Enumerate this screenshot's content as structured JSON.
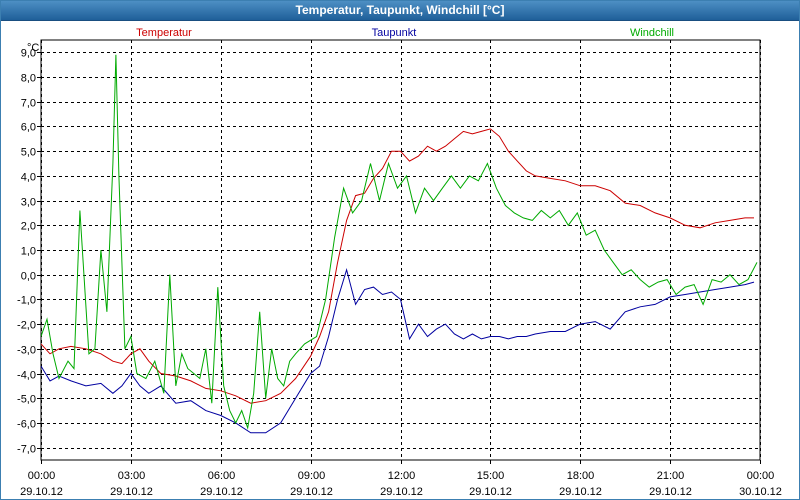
{
  "window": {
    "title": "Temperatur, Taupunkt, Windchill [°C]"
  },
  "chart_data": {
    "type": "line",
    "title": "Temperatur, Taupunkt, Windchill [°C]",
    "ylabel": "°C",
    "xlabel": "",
    "ylim": [
      -7.5,
      9.5
    ],
    "xlim": [
      0,
      24
    ],
    "grid": true,
    "legend_position": "top",
    "y_ticks": [
      "9,0",
      "8,0",
      "7,0",
      "6,0",
      "5,0",
      "4,0",
      "3,0",
      "2,0",
      "1,0",
      "0,0",
      "-1,0",
      "-2,0",
      "-3,0",
      "-4,0",
      "-5,0",
      "-6,0",
      "-7,0"
    ],
    "y_tick_values": [
      9,
      8,
      7,
      6,
      5,
      4,
      3,
      2,
      1,
      0,
      -1,
      -2,
      -3,
      -4,
      -5,
      -6,
      -7
    ],
    "x_ticks": [
      {
        "time": "00:00",
        "date": "29.10.12"
      },
      {
        "time": "03:00",
        "date": "29.10.12"
      },
      {
        "time": "06:00",
        "date": "29.10.12"
      },
      {
        "time": "09:00",
        "date": "29.10.12"
      },
      {
        "time": "12:00",
        "date": "29.10.12"
      },
      {
        "time": "15:00",
        "date": "29.10.12"
      },
      {
        "time": "18:00",
        "date": "29.10.12"
      },
      {
        "time": "21:00",
        "date": "29.10.12"
      },
      {
        "time": "00:00",
        "date": "30.10.12"
      }
    ],
    "x_tick_hours": [
      0,
      3,
      6,
      9,
      12,
      15,
      18,
      21,
      24
    ],
    "series": [
      {
        "name": "Temperatur",
        "color": "#cc0000",
        "x": [
          0,
          0.3,
          0.6,
          1.0,
          1.5,
          2.0,
          2.4,
          2.7,
          3.0,
          3.3,
          3.6,
          4.0,
          4.5,
          5.0,
          5.5,
          6.0,
          6.5,
          7.0,
          7.5,
          8.0,
          8.5,
          9.0,
          9.3,
          9.6,
          9.9,
          10.2,
          10.5,
          10.8,
          11.1,
          11.4,
          11.7,
          12.0,
          12.3,
          12.6,
          12.9,
          13.2,
          13.5,
          13.8,
          14.1,
          14.4,
          14.7,
          15.0,
          15.3,
          15.6,
          15.9,
          16.2,
          16.5,
          17.0,
          17.5,
          18.0,
          18.5,
          19.0,
          19.5,
          20.0,
          20.5,
          21.0,
          21.5,
          22.0,
          22.5,
          23.0,
          23.5,
          23.8
        ],
        "y": [
          -2.8,
          -3.2,
          -3.0,
          -2.9,
          -3.0,
          -3.2,
          -3.5,
          -3.6,
          -3.2,
          -3.0,
          -3.5,
          -4.0,
          -4.1,
          -4.3,
          -4.6,
          -4.7,
          -4.9,
          -5.2,
          -5.1,
          -4.8,
          -4.2,
          -3.3,
          -2.5,
          -1.5,
          0.5,
          2.2,
          3.2,
          3.3,
          3.9,
          4.3,
          5.0,
          5.0,
          4.6,
          4.8,
          5.2,
          5.0,
          5.2,
          5.5,
          5.8,
          5.7,
          5.8,
          5.9,
          5.6,
          5.0,
          4.6,
          4.2,
          4.0,
          3.9,
          3.8,
          3.6,
          3.6,
          3.4,
          2.9,
          2.8,
          2.5,
          2.3,
          2.0,
          1.9,
          2.1,
          2.2,
          2.3,
          2.3
        ]
      },
      {
        "name": "Taupunkt",
        "color": "#0000a0",
        "x": [
          0,
          0.3,
          0.6,
          1.0,
          1.5,
          2.0,
          2.4,
          2.7,
          3.0,
          3.3,
          3.6,
          4.0,
          4.5,
          5.0,
          5.5,
          6.0,
          6.5,
          7.0,
          7.5,
          8.0,
          8.5,
          9.0,
          9.3,
          9.6,
          9.9,
          10.2,
          10.5,
          10.8,
          11.1,
          11.4,
          11.7,
          12.0,
          12.3,
          12.6,
          12.9,
          13.2,
          13.5,
          13.8,
          14.1,
          14.4,
          14.7,
          15.0,
          15.3,
          15.6,
          15.9,
          16.2,
          16.5,
          17.0,
          17.5,
          18.0,
          18.5,
          19.0,
          19.5,
          20.0,
          20.5,
          21.0,
          21.5,
          22.0,
          22.5,
          23.0,
          23.5,
          23.8
        ],
        "y": [
          -3.7,
          -4.3,
          -4.1,
          -4.3,
          -4.5,
          -4.4,
          -4.8,
          -4.5,
          -4.0,
          -4.5,
          -4.8,
          -4.5,
          -5.2,
          -5.1,
          -5.5,
          -5.7,
          -6.0,
          -6.4,
          -6.4,
          -6.0,
          -5.0,
          -4.0,
          -3.7,
          -2.5,
          -1.0,
          0.2,
          -1.2,
          -0.6,
          -0.5,
          -0.8,
          -0.7,
          -1.0,
          -2.6,
          -2.0,
          -2.5,
          -2.2,
          -2.0,
          -2.4,
          -2.6,
          -2.4,
          -2.6,
          -2.5,
          -2.5,
          -2.6,
          -2.5,
          -2.5,
          -2.4,
          -2.3,
          -2.3,
          -2.0,
          -1.9,
          -2.2,
          -1.5,
          -1.3,
          -1.2,
          -0.9,
          -0.8,
          -0.7,
          -0.6,
          -0.5,
          -0.4,
          -0.3
        ]
      },
      {
        "name": "Windchill",
        "color": "#00aa00",
        "x": [
          0,
          0.2,
          0.4,
          0.6,
          0.9,
          1.1,
          1.3,
          1.6,
          1.8,
          2.0,
          2.2,
          2.4,
          2.5,
          2.6,
          2.8,
          3.0,
          3.2,
          3.5,
          3.8,
          4.1,
          4.3,
          4.5,
          4.7,
          4.9,
          5.1,
          5.3,
          5.5,
          5.7,
          5.9,
          6.1,
          6.3,
          6.5,
          6.7,
          6.9,
          7.1,
          7.3,
          7.5,
          7.7,
          7.9,
          8.1,
          8.3,
          8.5,
          8.8,
          9.2,
          9.5,
          9.8,
          10.1,
          10.4,
          10.7,
          11.0,
          11.3,
          11.6,
          11.9,
          12.2,
          12.5,
          12.8,
          13.1,
          13.4,
          13.7,
          14.0,
          14.3,
          14.6,
          14.9,
          15.2,
          15.5,
          15.8,
          16.1,
          16.4,
          16.7,
          17.0,
          17.3,
          17.6,
          17.9,
          18.2,
          18.5,
          18.8,
          19.1,
          19.4,
          19.7,
          20.0,
          20.3,
          20.6,
          20.9,
          21.2,
          21.5,
          21.8,
          22.1,
          22.4,
          22.7,
          23.0,
          23.3,
          23.6,
          23.9
        ],
        "y": [
          -2.5,
          -1.8,
          -3.2,
          -4.2,
          -3.5,
          -3.8,
          2.6,
          -3.2,
          -3.0,
          1.0,
          -1.5,
          4.5,
          8.9,
          4.0,
          -3.0,
          -2.5,
          -4.0,
          -4.2,
          -3.5,
          -4.8,
          0.0,
          -4.5,
          -3.2,
          -3.8,
          -4.0,
          -4.2,
          -3.0,
          -5.2,
          -0.5,
          -4.5,
          -5.5,
          -6.0,
          -5.5,
          -6.2,
          -4.8,
          -1.5,
          -5.0,
          -3.0,
          -4.2,
          -4.5,
          -3.5,
          -3.2,
          -2.8,
          -2.5,
          -1.0,
          1.5,
          3.5,
          2.5,
          3.0,
          4.5,
          3.0,
          4.5,
          3.5,
          4.0,
          2.5,
          3.5,
          3.0,
          3.5,
          4.0,
          3.5,
          4.0,
          3.8,
          4.5,
          3.5,
          2.8,
          2.5,
          2.3,
          2.2,
          2.6,
          2.3,
          2.6,
          2.0,
          2.5,
          1.6,
          1.8,
          1.0,
          0.5,
          0.0,
          0.2,
          -0.2,
          -0.5,
          -0.3,
          -0.2,
          -0.8,
          -0.5,
          -0.4,
          -1.2,
          -0.2,
          -0.3,
          0.0,
          -0.4,
          -0.2,
          0.5
        ]
      }
    ]
  }
}
